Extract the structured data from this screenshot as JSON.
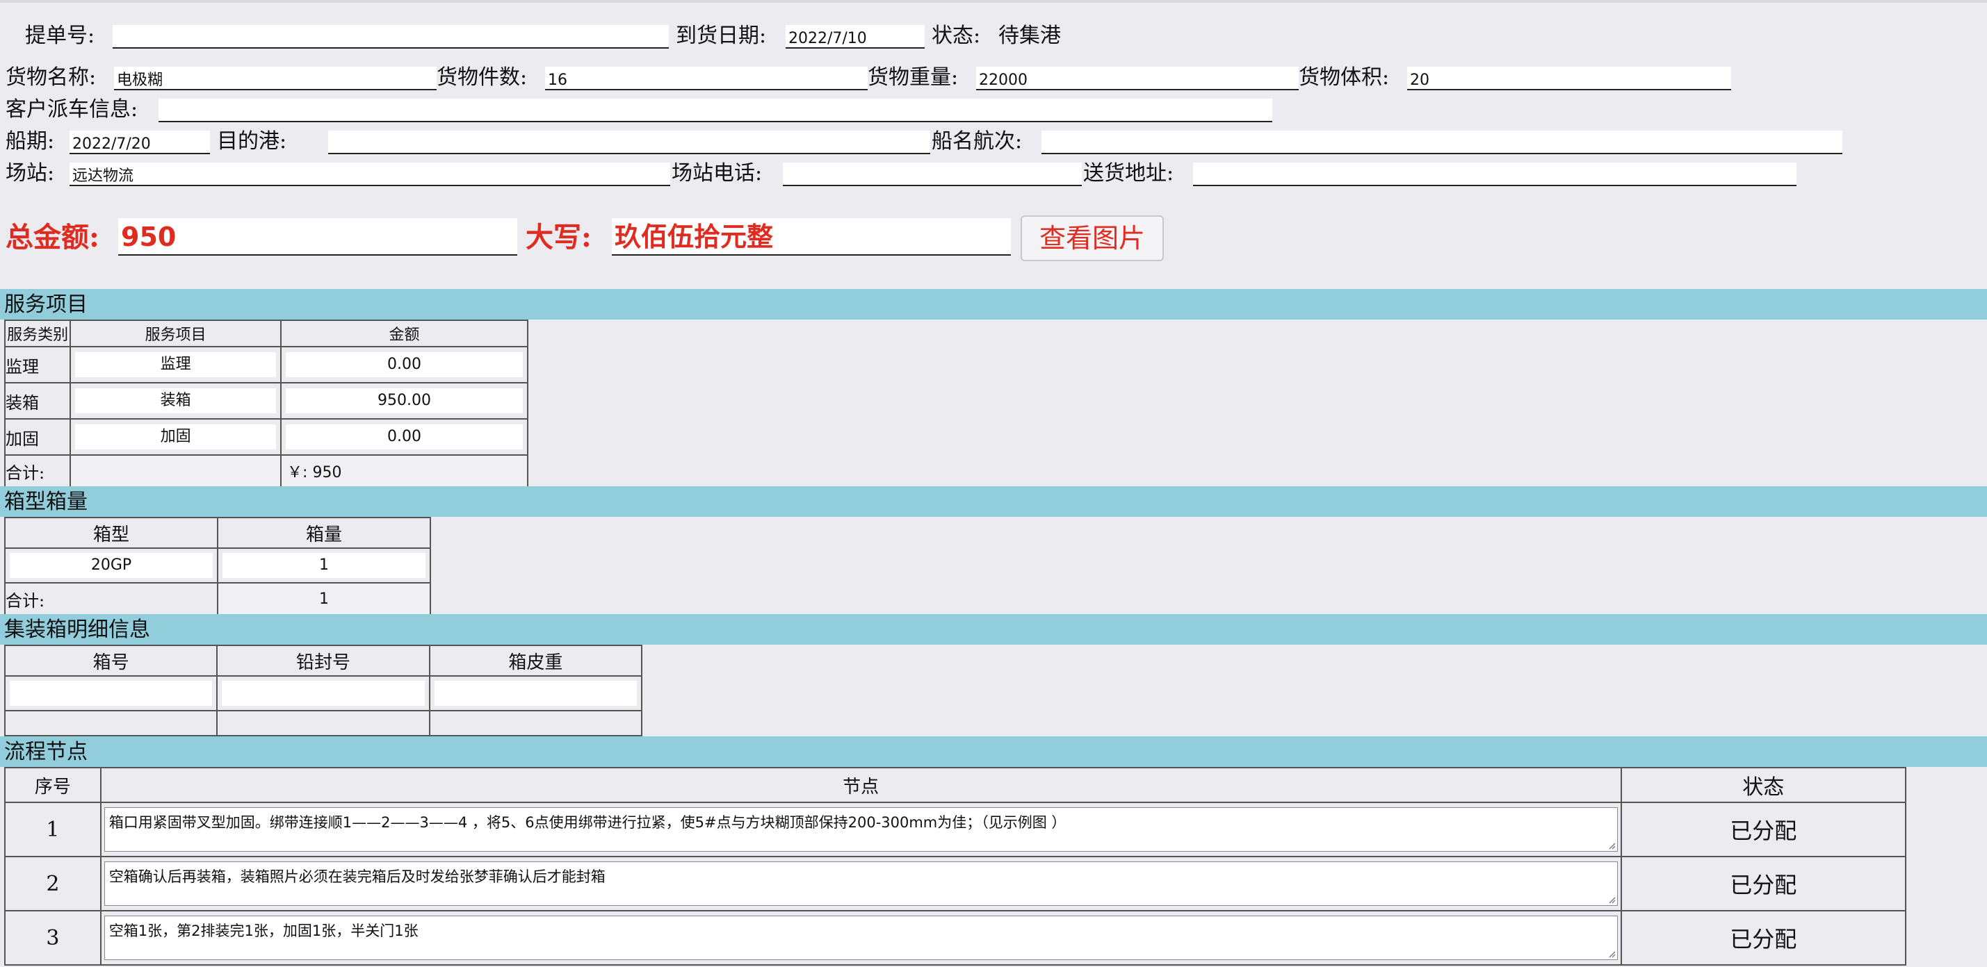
{
  "header": {
    "bill_no_label": "提单号:",
    "bill_no_value": "",
    "arrival_label": "到货日期:",
    "arrival_value": "2022/7/10",
    "status_label": "状态:",
    "status_value": "待集港"
  },
  "cargo": {
    "name_label": "货物名称:",
    "name_value": "电极糊",
    "count_label": "货物件数:",
    "count_value": "16",
    "weight_label": "货物重量:",
    "weight_value": "22000",
    "volume_label": "货物体积:",
    "volume_value": "20"
  },
  "dispatch": {
    "label": "客户派车信息:",
    "value": ""
  },
  "ship": {
    "date_label": "船期:",
    "date_value": "2022/7/20",
    "port_label": "目的港:",
    "port_value": "",
    "voyage_label": "船名航次:",
    "voyage_value": ""
  },
  "station": {
    "label": "场站:",
    "value": "远达物流",
    "phone_label": "场站电话:",
    "phone_value": "",
    "address_label": "送货地址:",
    "address_value": ""
  },
  "total": {
    "amount_label": "总金额:",
    "amount_value": "950",
    "caps_label": "大写:",
    "caps_value": "玖佰伍拾元整",
    "view_image_button": "查看图片"
  },
  "services": {
    "section_title": "服务项目",
    "headers": [
      "服务类别",
      "服务项目",
      "金额"
    ],
    "rows": [
      {
        "category": "监理",
        "item": "监理",
        "amount": "0.00"
      },
      {
        "category": "装箱",
        "item": "装箱",
        "amount": "950.00"
      },
      {
        "category": "加固",
        "item": "加固",
        "amount": "0.00"
      }
    ],
    "sum_label": "合计:",
    "sum_value": "￥:  950"
  },
  "containers": {
    "section_title": "箱型箱量",
    "headers": [
      "箱型",
      "箱量"
    ],
    "rows": [
      {
        "type": "20GP",
        "qty": "1"
      }
    ],
    "sum_label": "合计:",
    "sum_value": "1"
  },
  "container_detail": {
    "section_title": "集装箱明细信息",
    "headers": [
      "箱号",
      "铅封号",
      "箱皮重"
    ]
  },
  "flow": {
    "section_title": "流程节点",
    "headers": [
      "序号",
      "节点",
      "状态"
    ],
    "rows": [
      {
        "seq": "1",
        "node": "箱口用紧固带叉型加固。绑带连接顺1——2——3——4 ，将5、6点使用绑带进行拉紧，使5#点与方块糊顶部保持200-300mm为佳；（见示例图 ）",
        "status": "已分配"
      },
      {
        "seq": "2",
        "node": "空箱确认后再装箱，装箱照片必须在装完箱后及时发给张梦菲确认后才能封箱",
        "status": "已分配"
      },
      {
        "seq": "3",
        "node": " 空箱1张，第2排装完1张，加固1张，半关门1张",
        "status": "已分配"
      }
    ]
  },
  "colors": {
    "section_bar": "#92cddc",
    "accent_red": "#e02b20",
    "page_bg": "#ebebf0"
  }
}
